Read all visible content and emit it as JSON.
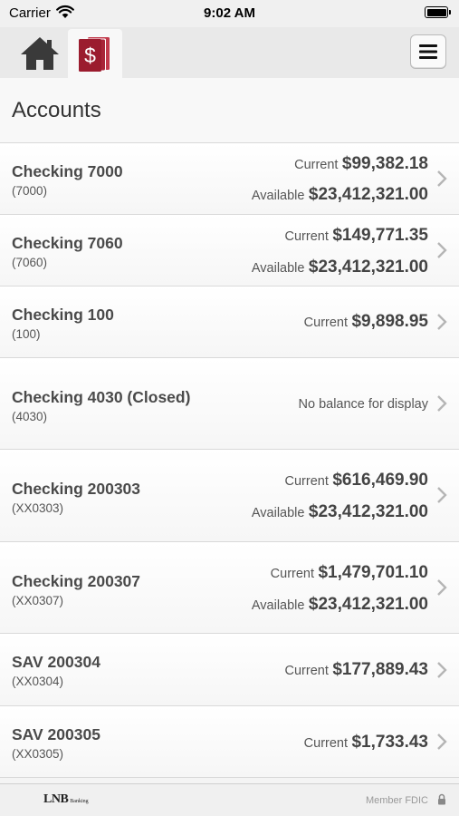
{
  "status_bar": {
    "carrier": "Carrier",
    "time": "9:02 AM"
  },
  "nav": {
    "home_icon": "home-icon",
    "accounts_icon": "accounts-dollar-icon",
    "menu_icon": "hamburger-menu-icon"
  },
  "page": {
    "title": "Accounts"
  },
  "accounts": [
    {
      "name": "Checking 7000",
      "number": "(7000)",
      "balances": [
        {
          "label": "Current",
          "amount": "$99,382.18"
        },
        {
          "label": "Available",
          "amount": "$23,412,321.00"
        }
      ]
    },
    {
      "name": "Checking 7060",
      "number": "(7060)",
      "balances": [
        {
          "label": "Current",
          "amount": "$149,771.35"
        },
        {
          "label": "Available",
          "amount": "$23,412,321.00"
        }
      ]
    },
    {
      "name": "Checking 100",
      "number": "(100)",
      "balances": [
        {
          "label": "Current",
          "amount": "$9,898.95"
        }
      ]
    },
    {
      "name": "Checking 4030 (Closed)",
      "number": "(4030)",
      "no_balance": "No balance for display"
    },
    {
      "name": "Checking 200303",
      "number": "(XX0303)",
      "balances": [
        {
          "label": "Current",
          "amount": "$616,469.90"
        },
        {
          "label": "Available",
          "amount": "$23,412,321.00"
        }
      ]
    },
    {
      "name": "Checking 200307",
      "number": "(XX0307)",
      "balances": [
        {
          "label": "Current",
          "amount": "$1,479,701.10"
        },
        {
          "label": "Available",
          "amount": "$23,412,321.00"
        }
      ]
    },
    {
      "name": "SAV 200304",
      "number": "(XX0304)",
      "balances": [
        {
          "label": "Current",
          "amount": "$177,889.43"
        }
      ]
    },
    {
      "name": "SAV 200305",
      "number": "(XX0305)",
      "balances": [
        {
          "label": "Current",
          "amount": "$1,733.43"
        }
      ]
    }
  ],
  "footer": {
    "logo_text": "LNB",
    "logo_subtext": "Banking",
    "fdic_text": "Member FDIC"
  },
  "colors": {
    "brand": "#9b1c2e",
    "nav_background": "#e9e9e9",
    "chevron": "#b5b5b5"
  }
}
